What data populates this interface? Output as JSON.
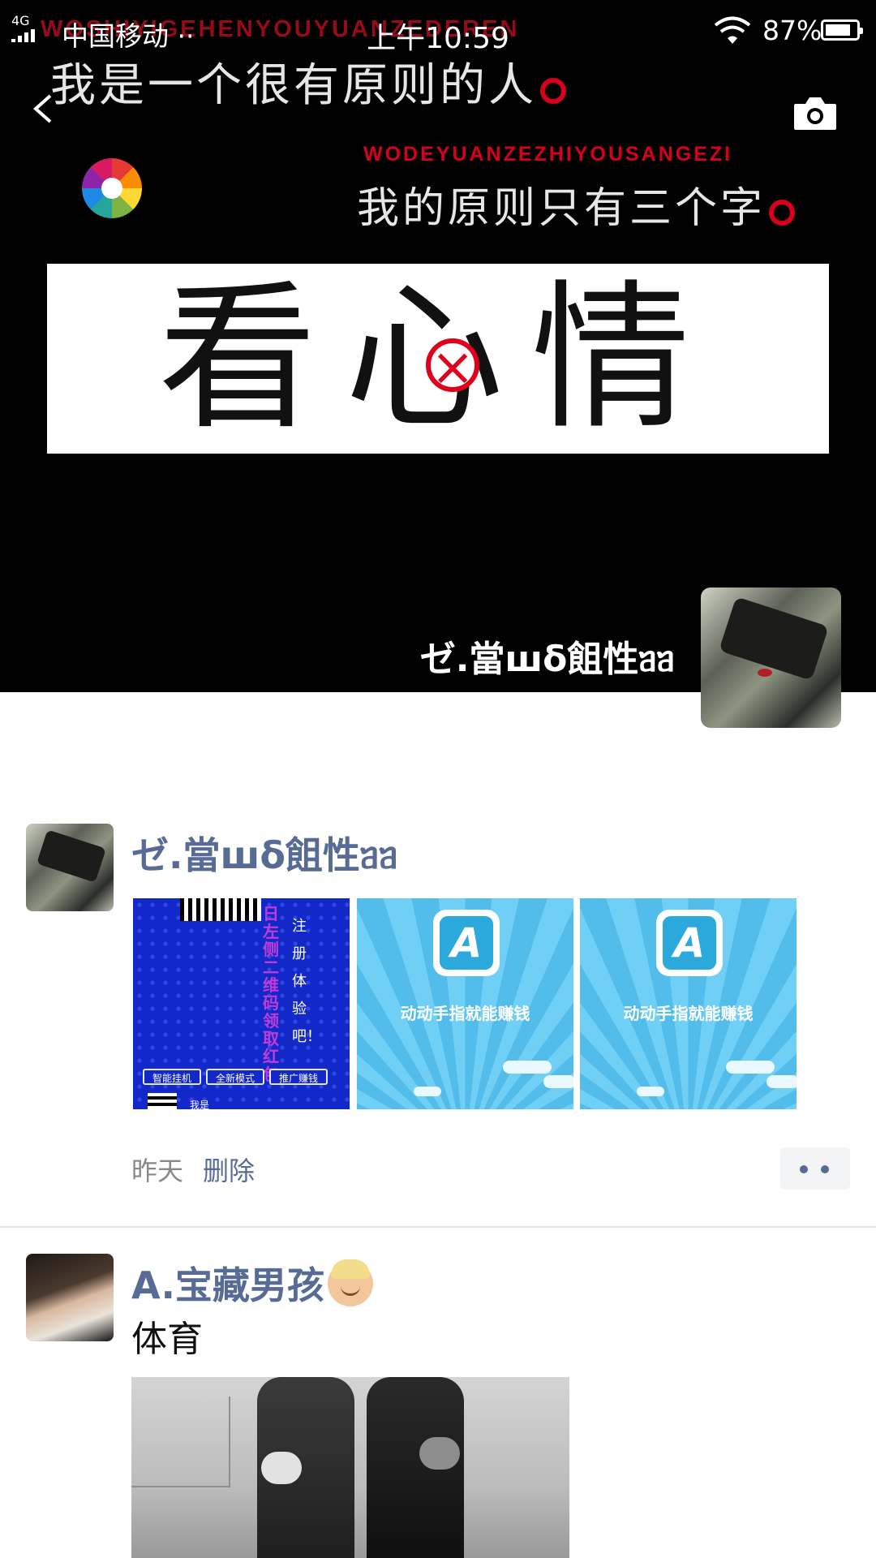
{
  "status_bar": {
    "network": "4G",
    "carrier": "中国移动 ··",
    "time": "上午10:59",
    "battery": "87%"
  },
  "cover": {
    "watermark_text": "WOSHIYIGEHENYOUYUANZEDEREN",
    "line1": "我是一个很有原则的人",
    "romanization": "WODEYUANZEZHIYOUSANGEZI",
    "line2": "我的原则只有三个字",
    "banner": "看心情",
    "owner_name": "ゼ.當шδ飷性ᥑᥑ"
  },
  "icons": {
    "back": "back-chevron-icon",
    "camera": "camera-icon",
    "color_wheel": "photo-app-icon",
    "more": "more-dots-icon"
  },
  "feed": [
    {
      "author": "ゼ.當шδ飷性ᥑᥑ",
      "images": [
        {
          "vertical_text": "日左侧二维码领取红包",
          "side_text": "注册体验吧！",
          "buttons": [
            "智能挂机",
            "全新模式",
            "推广赚钱"
          ],
          "footer": "我是"
        },
        {
          "caption": "动动手指就能赚钱"
        },
        {
          "caption": "动动手指就能赚钱"
        }
      ],
      "time": "昨天",
      "delete_label": "删除"
    },
    {
      "author": "A.宝藏男孩",
      "text": "体育"
    }
  ],
  "colors": {
    "link": "#576b95",
    "cover_bg": "#000000",
    "accent_red": "#d6001c"
  }
}
